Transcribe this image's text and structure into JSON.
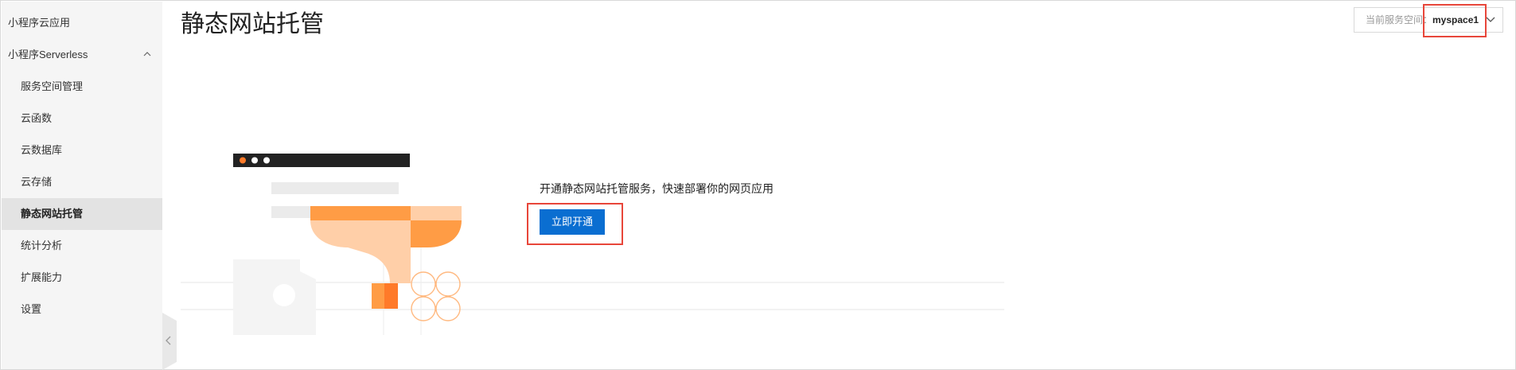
{
  "sidebar": {
    "items": [
      {
        "label": "小程序云应用"
      },
      {
        "label": "小程序Serverless"
      },
      {
        "label": "服务空间管理"
      },
      {
        "label": "云函数"
      },
      {
        "label": "云数据库"
      },
      {
        "label": "云存储"
      },
      {
        "label": "静态网站托管"
      },
      {
        "label": "统计分析"
      },
      {
        "label": "扩展能力"
      },
      {
        "label": "设置"
      }
    ],
    "active_item": "静态网站托管"
  },
  "header": {
    "title": "静态网站托管",
    "space_selector": {
      "label": "当前服务空间：",
      "value": "myspace1"
    }
  },
  "empty_state": {
    "description": "开通静态网站托管服务，快速部署你的网页应用",
    "button_label": "立即开通"
  },
  "colors": {
    "primary": "#0a6ed1",
    "highlight": "#e8463a",
    "illustration_orange": "#ff9c45",
    "illustration_light": "#ffcfa8"
  },
  "icons": [
    "chevron-up-icon",
    "chevron-down-icon",
    "chevron-left-icon"
  ]
}
